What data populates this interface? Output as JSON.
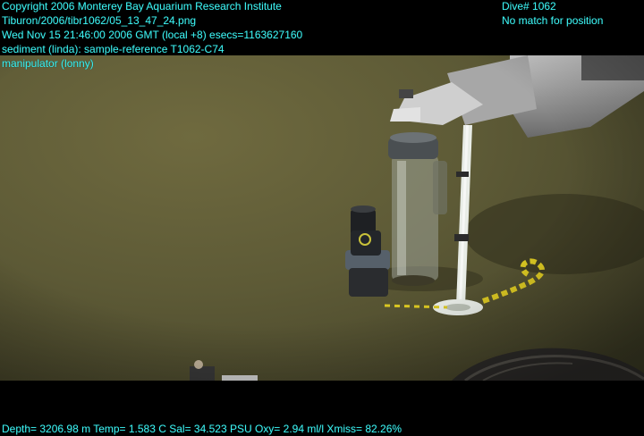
{
  "overlay": {
    "copyright": "Copyright 2006 Monterey Bay Aquarium Research Institute",
    "filename": "Tiburon/2006/tibr1062/05_13_47_24.png",
    "datetime": "Wed Nov 15 21:46:00 2006 GMT (local +8)  esecs=1163627160",
    "sample": "sediment (linda): sample-reference T1062-C74",
    "manipulator": "manipulator (lonny)",
    "dive": "Dive# 1062",
    "position": "No match for position",
    "telemetry": "Depth= 3206.98 m  Temp= 1.583 C  Sal= 34.523 PSU  Oxy= 2.94 ml/l  Xmiss= 82.26%"
  },
  "colors": {
    "overlay_text": "#3df2f2",
    "seafloor": "#5d5a36"
  }
}
